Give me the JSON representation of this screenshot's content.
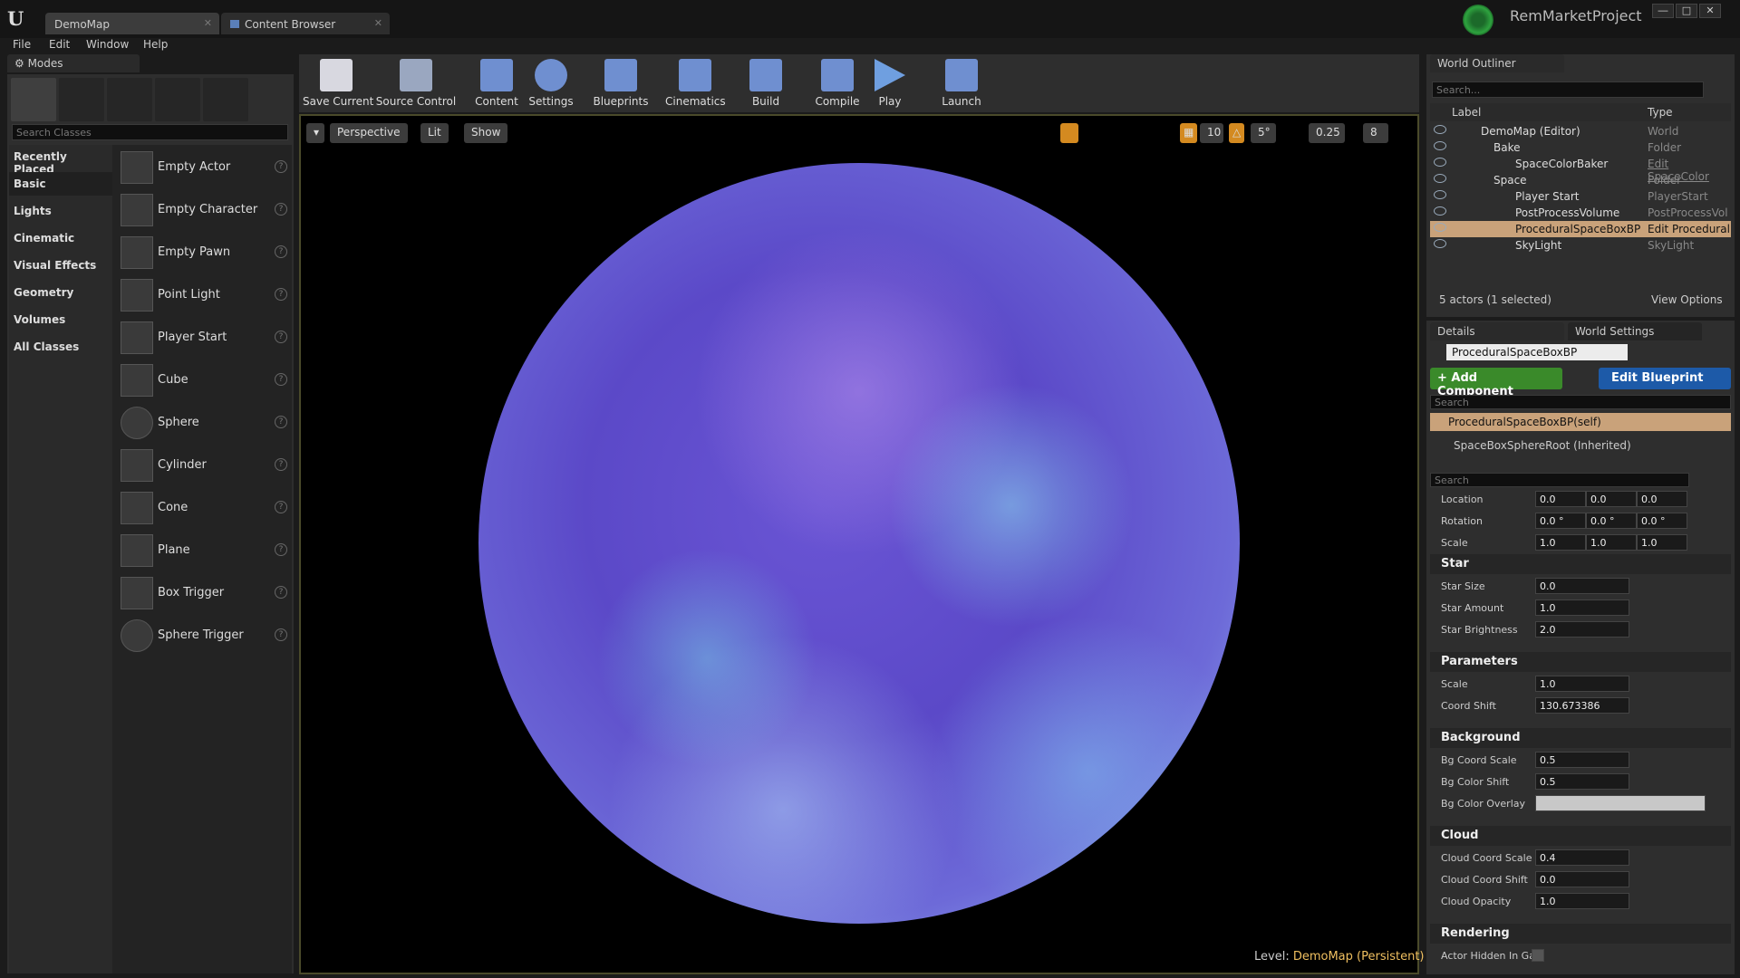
{
  "window": {
    "tabs": [
      "DemoMap",
      "Content Browser"
    ],
    "project_name": "RemMarketProject",
    "controls": [
      "―",
      "□",
      "✕"
    ]
  },
  "menu": [
    "File",
    "Edit",
    "Window",
    "Help"
  ],
  "modes": {
    "tab_label": "Modes",
    "search_placeholder": "Search Classes",
    "categories": [
      "Recently Placed",
      "Basic",
      "Lights",
      "Cinematic",
      "Visual Effects",
      "Geometry",
      "Volumes",
      "All Classes"
    ],
    "selected_category": "Basic",
    "items": [
      "Empty Actor",
      "Empty Character",
      "Empty Pawn",
      "Point Light",
      "Player Start",
      "Cube",
      "Sphere",
      "Cylinder",
      "Cone",
      "Plane",
      "Box Trigger",
      "Sphere Trigger"
    ]
  },
  "toolbar": {
    "buttons": [
      "Save Current",
      "Source Control",
      "Content",
      "Settings",
      "Blueprints",
      "Cinematics",
      "Build",
      "Compile",
      "Play",
      "Launch"
    ]
  },
  "viewport": {
    "view_mode": "Perspective",
    "lighting": "Lit",
    "show": "Show",
    "grid_snap": "10",
    "rotation_snap": "5°",
    "scale_snap": "0.25",
    "camera_speed": "8",
    "level_label": "Level:",
    "level_value": "DemoMap (Persistent)"
  },
  "outliner": {
    "tab_label": "World Outliner",
    "search_placeholder": "Search...",
    "col_label": "Label",
    "col_type": "Type",
    "rows": [
      {
        "label": "DemoMap (Editor)",
        "type": "World"
      },
      {
        "label": "Bake",
        "type": "Folder"
      },
      {
        "label": "SpaceColorBaker",
        "type": "Edit SpaceColor"
      },
      {
        "label": "Space",
        "type": "Folder"
      },
      {
        "label": "Player Start",
        "type": "PlayerStart"
      },
      {
        "label": "PostProcessVolume",
        "type": "PostProcessVol"
      },
      {
        "label": "ProceduralSpaceBoxBP",
        "type": "Edit Procedural"
      },
      {
        "label": "SkyLight",
        "type": "SkyLight"
      }
    ],
    "status": "5 actors (1 selected)",
    "view_options": "View Options"
  },
  "details": {
    "tab_details": "Details",
    "tab_world_settings": "World Settings",
    "actor_name": "ProceduralSpaceBoxBP",
    "add_component": "+ Add Component",
    "edit_blueprint": "Edit Blueprint",
    "search_placeholder": "Search",
    "components": [
      "ProceduralSpaceBoxBP(self)",
      "SpaceBoxSphereRoot (Inherited)"
    ],
    "transform": {
      "location_label": "Location",
      "location": [
        "0.0",
        "0.0",
        "0.0"
      ],
      "rotation_label": "Rotation",
      "rotation": [
        "0.0 °",
        "0.0 °",
        "0.0 °"
      ],
      "scale_label": "Scale",
      "scale": [
        "1.0",
        "1.0",
        "1.0"
      ]
    },
    "sections": [
      {
        "title": "Star",
        "props": [
          [
            "Star Size",
            "0.0"
          ],
          [
            "Star Amount",
            "1.0"
          ],
          [
            "Star Brightness",
            "2.0"
          ]
        ]
      },
      {
        "title": "Parameters",
        "props": [
          [
            "Scale",
            "1.0"
          ],
          [
            "Coord Shift",
            "130.673386"
          ]
        ]
      },
      {
        "title": "Background",
        "props": [
          [
            "Bg Coord Scale",
            "0.5"
          ],
          [
            "Bg Color Shift",
            "0.5"
          ],
          [
            "Bg Color Overlay",
            ""
          ]
        ]
      },
      {
        "title": "Cloud",
        "props": [
          [
            "Cloud Coord Scale",
            "0.4"
          ],
          [
            "Cloud Coord Shift",
            "0.0"
          ],
          [
            "Cloud Opacity",
            "1.0"
          ]
        ]
      },
      {
        "title": "Rendering",
        "props": [
          [
            "Actor Hidden In Gar",
            ""
          ]
        ]
      }
    ]
  },
  "colors": {
    "accent_orange": "#f0a030",
    "selection": "#c9a27a",
    "add_component_green": "#3a8a2a",
    "edit_blueprint_blue": "#1d5aa8"
  }
}
